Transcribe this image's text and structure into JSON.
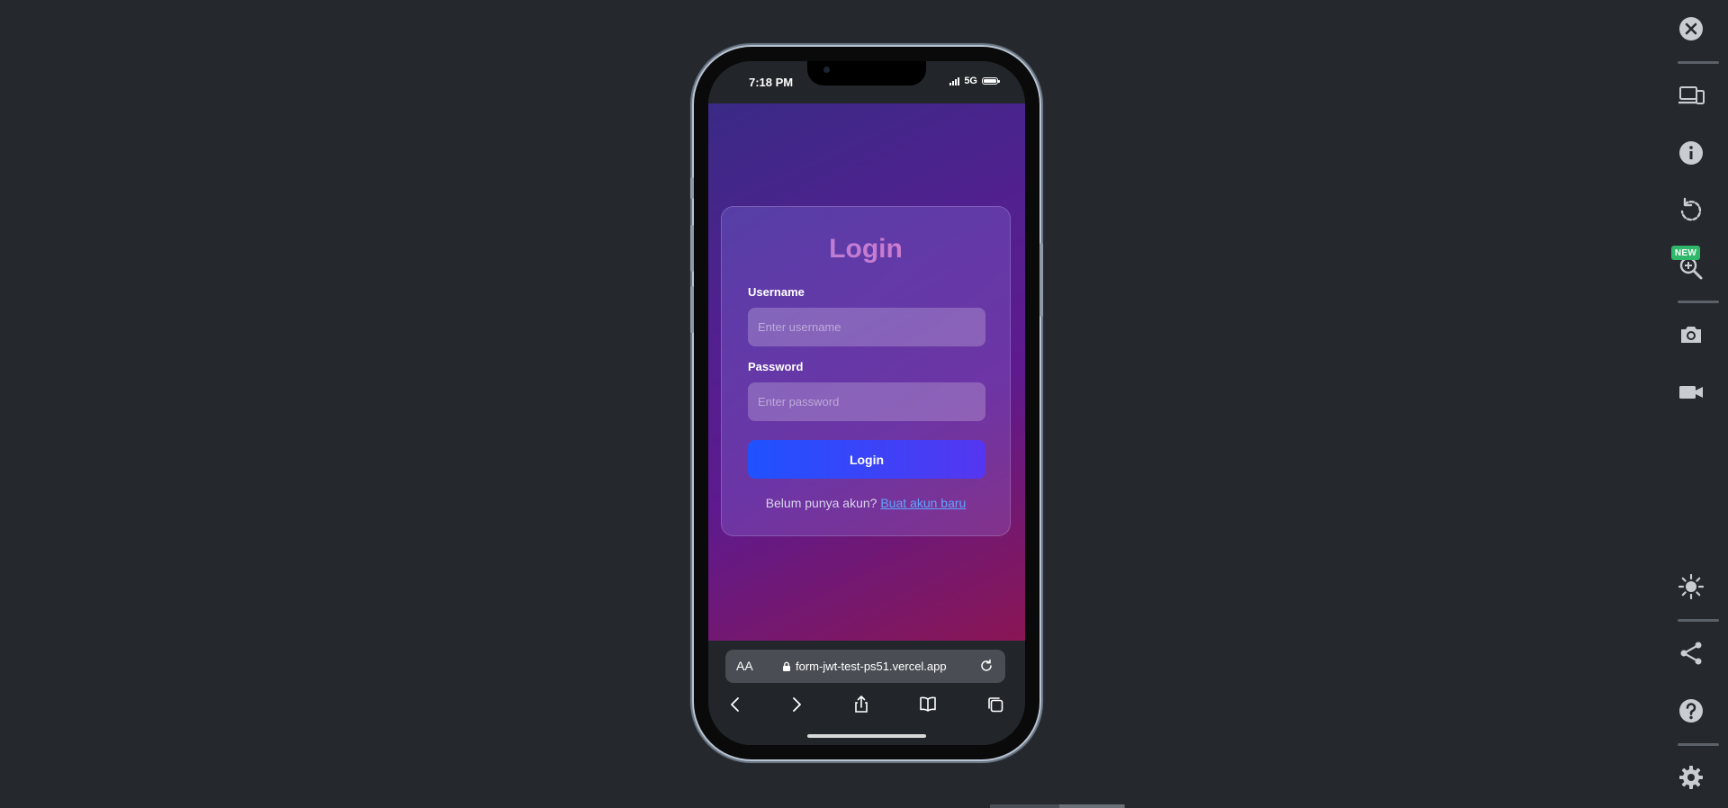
{
  "device": {
    "status_time": "7:18 PM",
    "network": "5G"
  },
  "page": {
    "title": "Login",
    "username_label": "Username",
    "username_placeholder": "Enter username",
    "password_label": "Password",
    "password_placeholder": "Enter password",
    "login_button": "Login",
    "register_prompt": "Belum punya akun?",
    "register_link": "Buat akun baru"
  },
  "browser": {
    "text_size_label": "AA",
    "url": "form-jwt-test-ps51.vercel.app",
    "nav_icons": [
      "back-icon",
      "forward-icon",
      "share-icon",
      "bookmarks-icon",
      "tabs-icon"
    ]
  },
  "toolbar": {
    "new_badge": "NEW",
    "icons": [
      "close-icon",
      "devices-icon",
      "info-icon",
      "rotate-icon",
      "zoom-icon",
      "camera-icon",
      "video-icon",
      "brightness-icon",
      "share-icon",
      "help-icon",
      "settings-icon"
    ]
  },
  "colors": {
    "background": "#25292e",
    "accent_button": "#1f52ff",
    "link": "#5ea4ff",
    "badge": "#2fb869"
  }
}
